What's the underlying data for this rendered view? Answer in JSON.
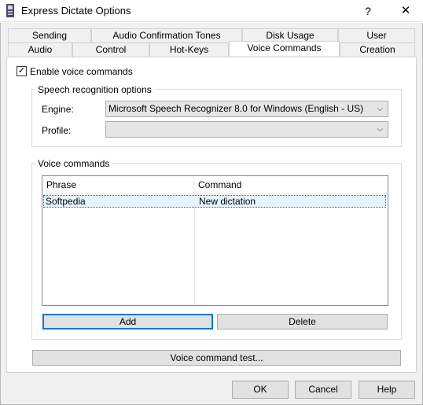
{
  "window": {
    "title": "Express Dictate Options",
    "help": "?",
    "close": "✕"
  },
  "tabs_top": [
    "Sending",
    "Audio Confirmation Tones",
    "Disk Usage",
    "User"
  ],
  "tabs_bottom": [
    "Audio",
    "Control",
    "Hot-Keys",
    "Voice Commands",
    "Creation"
  ],
  "enable_voice": {
    "label": "Enable voice commands",
    "checked": true
  },
  "speech": {
    "title": "Speech recognition options",
    "engine_label": "Engine:",
    "engine_value": "Microsoft Speech Recognizer 8.0 for Windows (English - US)",
    "profile_label": "Profile:",
    "profile_value": ""
  },
  "voice_commands": {
    "title": "Voice commands",
    "columns": [
      "Phrase",
      "Command"
    ],
    "rows": [
      {
        "phrase": "Softpedia",
        "command": "New dictation"
      }
    ],
    "add_label": "Add",
    "delete_label": "Delete"
  },
  "test_button": "Voice command test...",
  "footer": {
    "ok": "OK",
    "cancel": "Cancel",
    "help": "Help"
  }
}
